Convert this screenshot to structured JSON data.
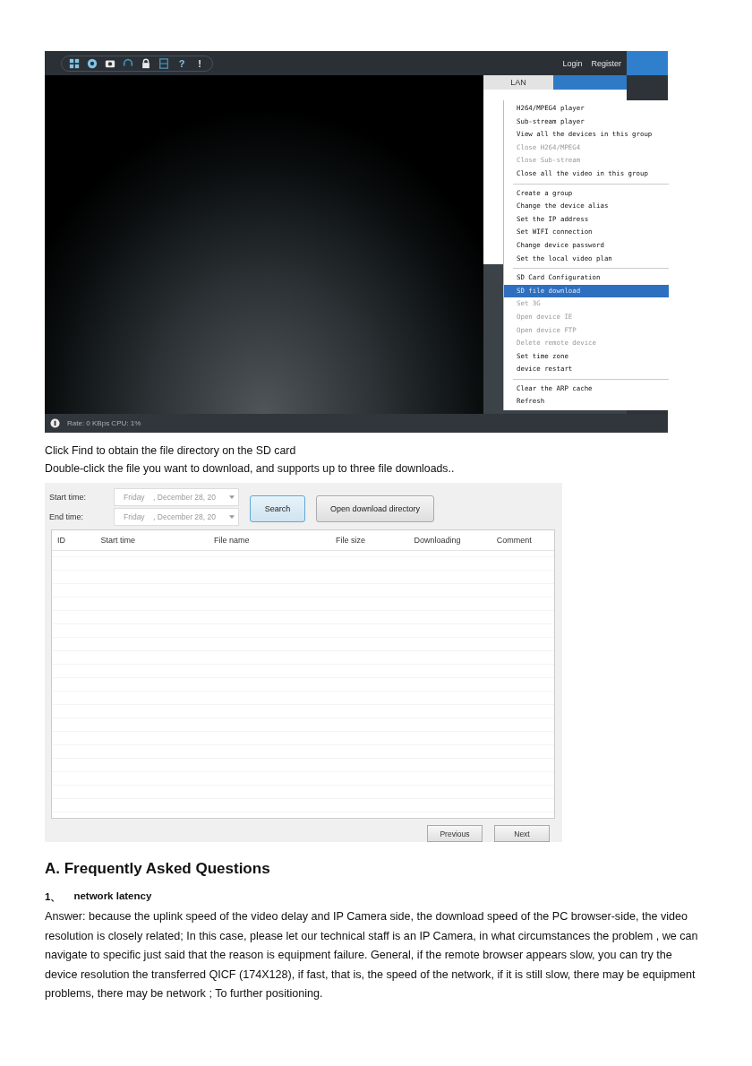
{
  "player": {
    "toolbar_glyphs": [
      "?",
      "!"
    ],
    "top_links": [
      "Login",
      "Register"
    ],
    "tabs": [
      {
        "label": "LAN",
        "selected": false
      },
      {
        "selected": true
      }
    ],
    "context_menu": [
      [
        {
          "label": "H264/MPEG4 player",
          "disabled": false,
          "selected": false
        },
        {
          "label": "Sub-stream player",
          "disabled": false,
          "selected": false
        },
        {
          "label": "View all the devices in this group",
          "disabled": false,
          "selected": false
        },
        {
          "label": "Close H264/MPEG4",
          "disabled": true,
          "selected": false
        },
        {
          "label": "Close Sub-stream",
          "disabled": true,
          "selected": false
        },
        {
          "label": "Close all the video in this group",
          "disabled": false,
          "selected": false
        }
      ],
      [
        {
          "label": "Create a group",
          "disabled": false,
          "selected": false
        },
        {
          "label": "Change the device alias",
          "disabled": false,
          "selected": false
        },
        {
          "label": "Set the IP address",
          "disabled": false,
          "selected": false
        },
        {
          "label": "Set WIFI connection",
          "disabled": false,
          "selected": false
        },
        {
          "label": "Change device password",
          "disabled": false,
          "selected": false
        },
        {
          "label": "Set the local video plan",
          "disabled": false,
          "selected": false
        }
      ],
      [
        {
          "label": "SD Card Configuration",
          "disabled": false,
          "selected": false
        },
        {
          "label": "SD file download",
          "disabled": false,
          "selected": true
        },
        {
          "label": "Set 3G",
          "disabled": true,
          "selected": false
        },
        {
          "label": "Open device IE",
          "disabled": true,
          "selected": false
        },
        {
          "label": "Open device FTP",
          "disabled": true,
          "selected": false
        },
        {
          "label": "Delete remote device",
          "disabled": true,
          "selected": false
        },
        {
          "label": "Set time zone",
          "disabled": false,
          "selected": false
        },
        {
          "label": "device restart",
          "disabled": false,
          "selected": false
        }
      ],
      [
        {
          "label": "Clear the ARP cache",
          "disabled": false,
          "selected": false
        },
        {
          "label": "Refresh",
          "disabled": false,
          "selected": false
        }
      ]
    ],
    "status_bar": "Rate: 0 KBps CPU: 1%"
  },
  "captions": [
    "Click Find to obtain the file directory on the SD card",
    "Double-click the file you want to download, and supports up to three file downloads.."
  ],
  "download_dialog": {
    "fields": [
      {
        "label": "Start time:",
        "value": "Friday    , December 28, 20"
      },
      {
        "label": "End time:",
        "value": "Friday    , December 28, 20"
      }
    ],
    "buttons": [
      {
        "label": "Search",
        "focused": true
      },
      {
        "label": "Open download directory",
        "focused": false
      }
    ],
    "columns": [
      "ID",
      "Start time",
      "File name",
      "File size",
      "Downloading",
      "Comment"
    ],
    "pager": [
      "Previous",
      "Next"
    ]
  },
  "faq": {
    "heading": "A. Frequently Asked Questions",
    "questions": [
      {
        "number": "1、",
        "title": "network latency",
        "answer": "Answer: because the uplink speed of the video delay and IP Camera side, the download speed of the PC browser-side, the video resolution is closely related; In this case, please let our technical staff is an IP Camera, in what circumstances the problem , we can navigate to specific just said that the reason is equipment failure. General, if the remote browser appears slow, you can try the device resolution the transferred QICF (174X128), if fast, that is, the speed of the network, if it is still slow, there may be equipment problems, there may be network ; To further positioning."
      }
    ]
  }
}
